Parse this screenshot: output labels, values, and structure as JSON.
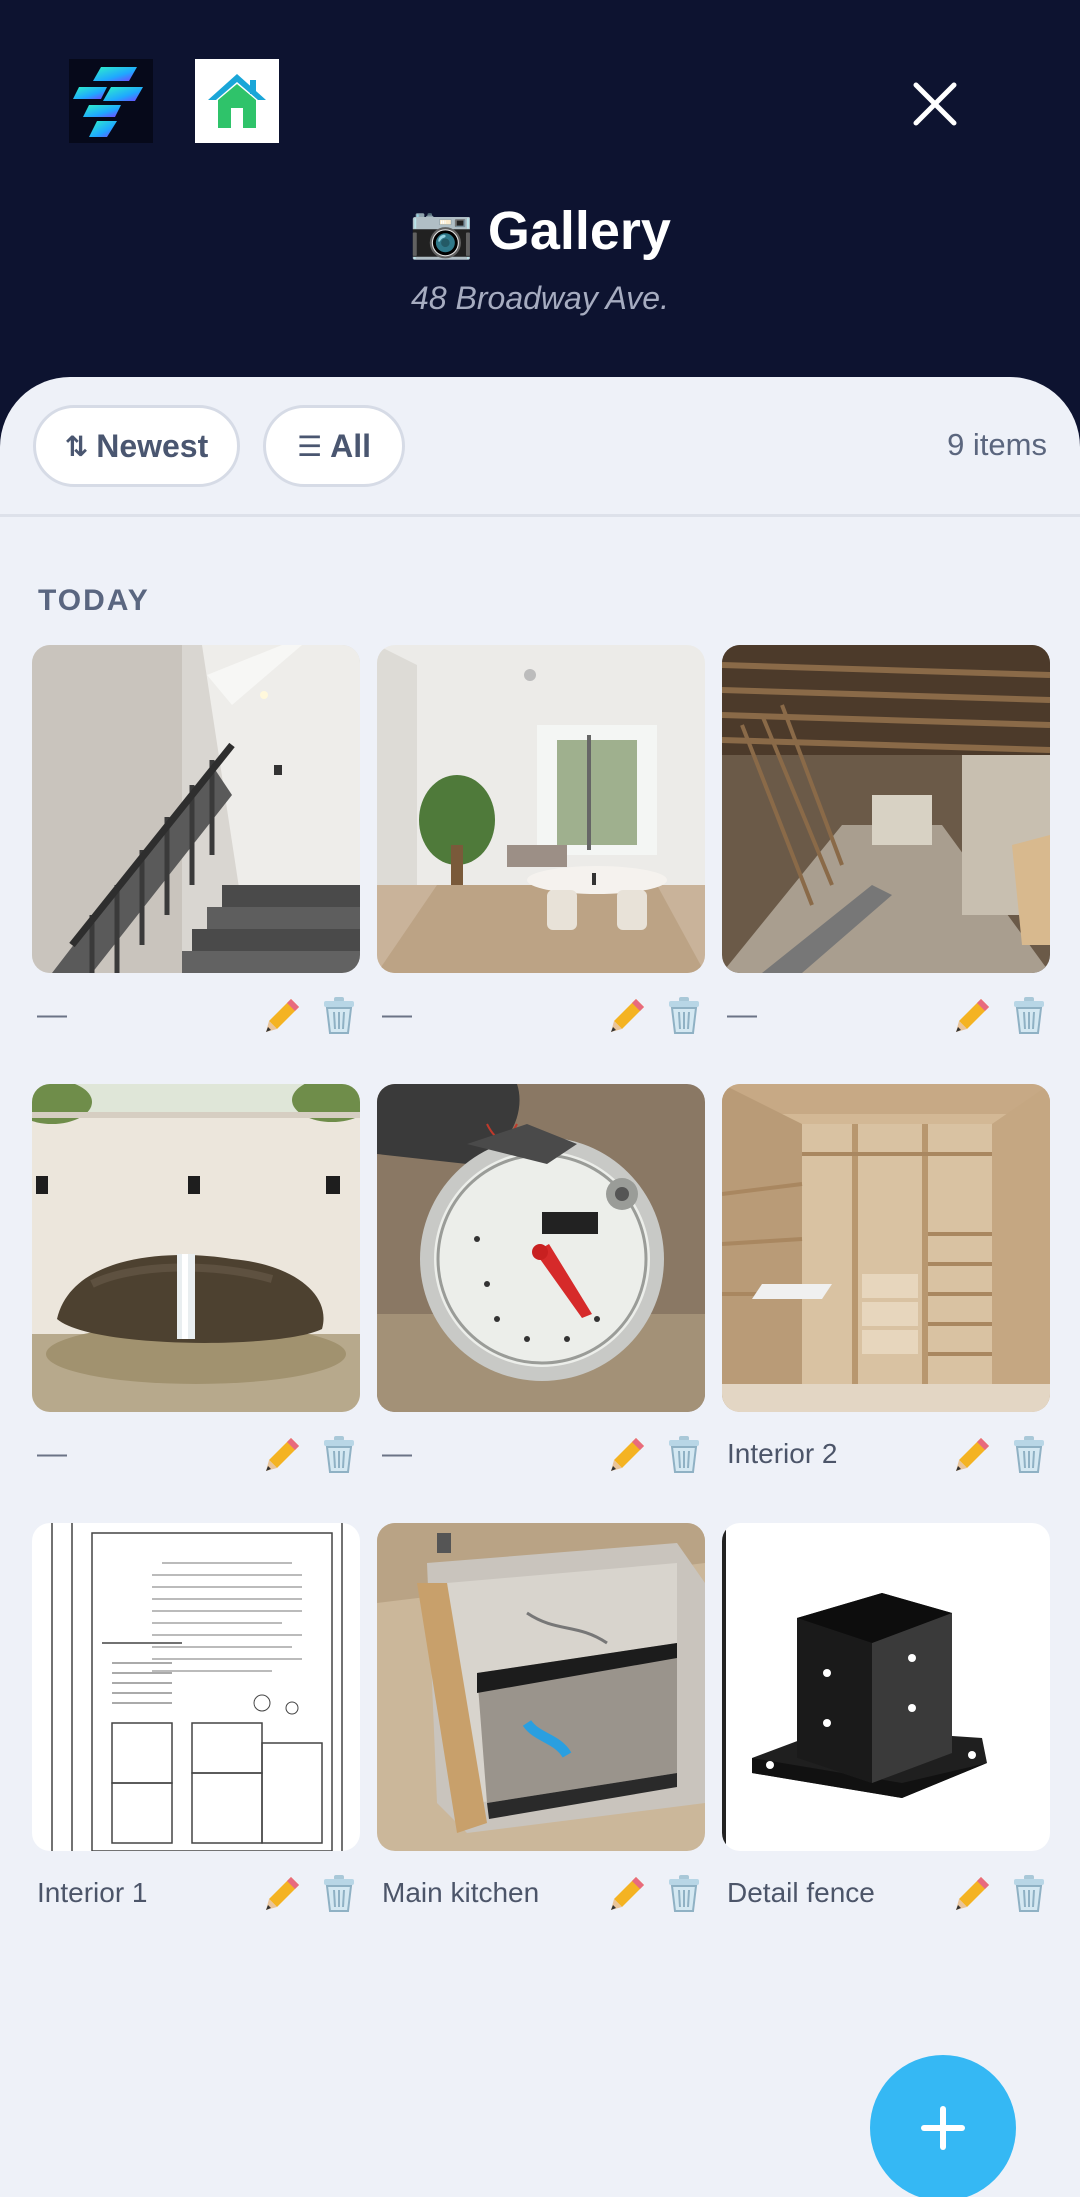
{
  "header": {
    "app_logo_icon": "lightning-bolt-logo-icon",
    "home_logo_icon": "house-logo-icon",
    "close_icon": "close-icon",
    "title_emoji": "📷",
    "title": "Gallery",
    "subtitle": "48 Broadway Ave."
  },
  "toolbar": {
    "sort_glyph": "⇅",
    "sort_label": "Newest",
    "filter_glyph": "☰",
    "filter_label": "All",
    "item_count": "9 items"
  },
  "section": {
    "title": "TODAY"
  },
  "items": [
    {
      "caption": "—",
      "image": "staircase"
    },
    {
      "caption": "—",
      "image": "living-room"
    },
    {
      "caption": "—",
      "image": "construction-interior"
    },
    {
      "caption": "—",
      "image": "rock-fountain"
    },
    {
      "caption": "—",
      "image": "water-meter"
    },
    {
      "caption": "Interior 2",
      "image": "closet-shelving"
    },
    {
      "caption": "Interior 1",
      "image": "floor-plan"
    },
    {
      "caption": "Main kitchen",
      "image": "cabinet-box"
    },
    {
      "caption": "Detail fence",
      "image": "post-base-bracket"
    }
  ],
  "icons": {
    "edit": "pencil-icon",
    "delete": "trash-icon",
    "add": "plus-icon"
  },
  "colors": {
    "header_bg": "#0d1330",
    "sheet_bg": "#eef1f8",
    "fab": "#35b8f4"
  }
}
